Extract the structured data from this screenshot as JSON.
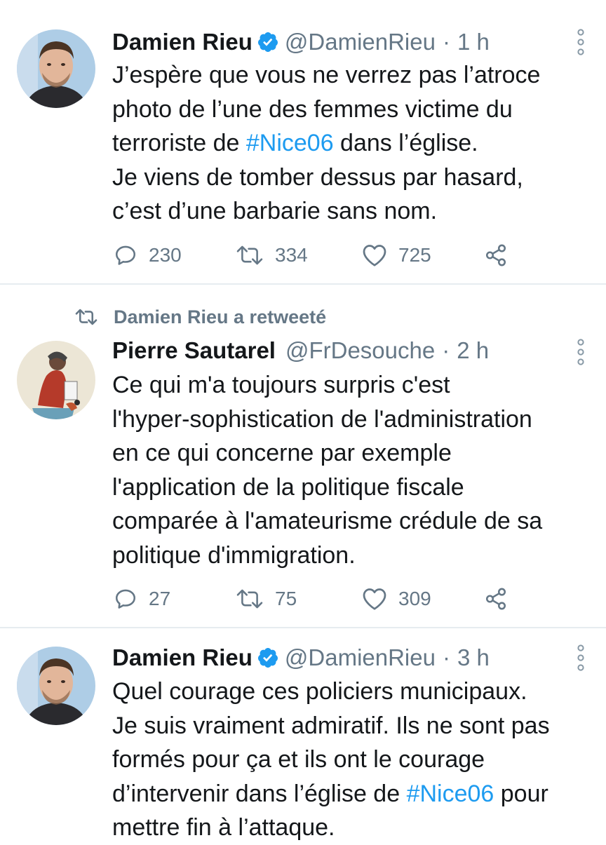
{
  "tweets": [
    {
      "author": "Damien Rieu",
      "verified": true,
      "handle": "@DamienRieu",
      "separator": "·",
      "time": "1 h",
      "lines": [
        [
          "J’espère que vous ne verrez pas l’atroce"
        ],
        [
          "photo de l’une des femmes victime du"
        ],
        [
          "terroriste de ",
          "#Nice06",
          " dans l’église."
        ],
        [
          "Je viens de tomber dessus par hasard,"
        ],
        [
          "c’est d’une barbarie sans nom."
        ]
      ],
      "replies": "230",
      "retweets": "334",
      "likes": "725"
    },
    {
      "retweeted_by": "Damien Rieu a retweeté",
      "author": "Pierre Sautarel",
      "verified": false,
      "handle": "@FrDesouche",
      "separator": "·",
      "time": "2 h",
      "lines": [
        [
          "Ce qui m'a toujours surpris c'est"
        ],
        [
          "l'hyper-sophistication de l'administration"
        ],
        [
          "en ce qui concerne par exemple"
        ],
        [
          "l'application de la politique fiscale"
        ],
        [
          "comparée à l'amateurisme crédule de sa"
        ],
        [
          "politique d'immigration."
        ]
      ],
      "replies": "27",
      "retweets": "75",
      "likes": "309"
    },
    {
      "author": "Damien Rieu",
      "verified": true,
      "handle": "@DamienRieu",
      "separator": "·",
      "time": "3 h",
      "lines": [
        [
          "Quel courage ces policiers municipaux."
        ],
        [
          "Je suis vraiment admiratif. Ils ne sont pas"
        ],
        [
          "formés pour ça et ils ont le courage"
        ],
        [
          "d’intervenir dans l’église de ",
          "#Nice06",
          " pour"
        ],
        [
          "mettre fin à l’attaque."
        ]
      ]
    }
  ],
  "colors": {
    "text": "#14171a",
    "secondary": "#657786",
    "hashtag": "#1d9bf0",
    "verified": "#1d9bf0",
    "divider": "#e6ecf0"
  },
  "icons": {
    "verified": "verified-badge-icon",
    "more": "more-vertical-icon",
    "reply": "reply-icon",
    "retweet": "retweet-icon",
    "like": "heart-icon",
    "share": "share-icon"
  }
}
